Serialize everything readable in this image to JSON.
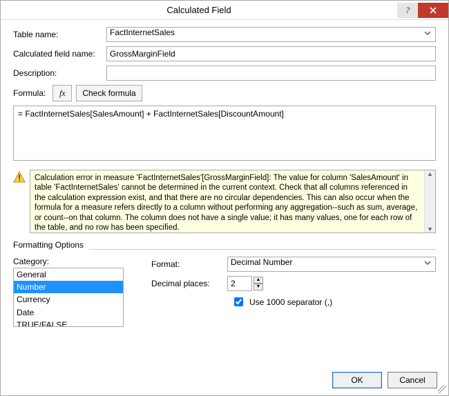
{
  "window": {
    "title": "Calculated Field"
  },
  "labels": {
    "table_name": "Table name:",
    "calc_field_name": "Calculated field name:",
    "description": "Description:",
    "formula": "Formula:",
    "check_formula": "Check formula",
    "fx": "fx",
    "formatting_options": "Formatting Options",
    "category": "Category:",
    "format": "Format:",
    "decimal_places": "Decimal places:",
    "use_1000_sep": "Use 1000 separator (,)",
    "ok": "OK",
    "cancel": "Cancel"
  },
  "values": {
    "table_name": "FactInternetSales",
    "calc_field_name": "GrossMarginField",
    "description": "",
    "formula": "= FactInternetSales[SalesAmount] + FactInternetSales[DiscountAmount]",
    "error_text": "Calculation error in measure 'FactInternetSales'[GrossMarginField]: The value for column 'SalesAmount' in table 'FactInternetSales' cannot be determined in the current context. Check that all columns referenced in the calculation expression exist, and that there are no circular dependencies. This can also occur when the formula for a measure refers directly to a column without performing any aggregation--such as sum, average, or count--on that column. The column does not have a single value; it has many values, one for each row of the table, and no row has been specified.",
    "categories": [
      "General",
      "Number",
      "Currency",
      "Date",
      "TRUE/FALSE"
    ],
    "category_selected_index": 1,
    "format_selected": "Decimal Number",
    "decimal_places": "2",
    "use_1000_sep": true
  }
}
